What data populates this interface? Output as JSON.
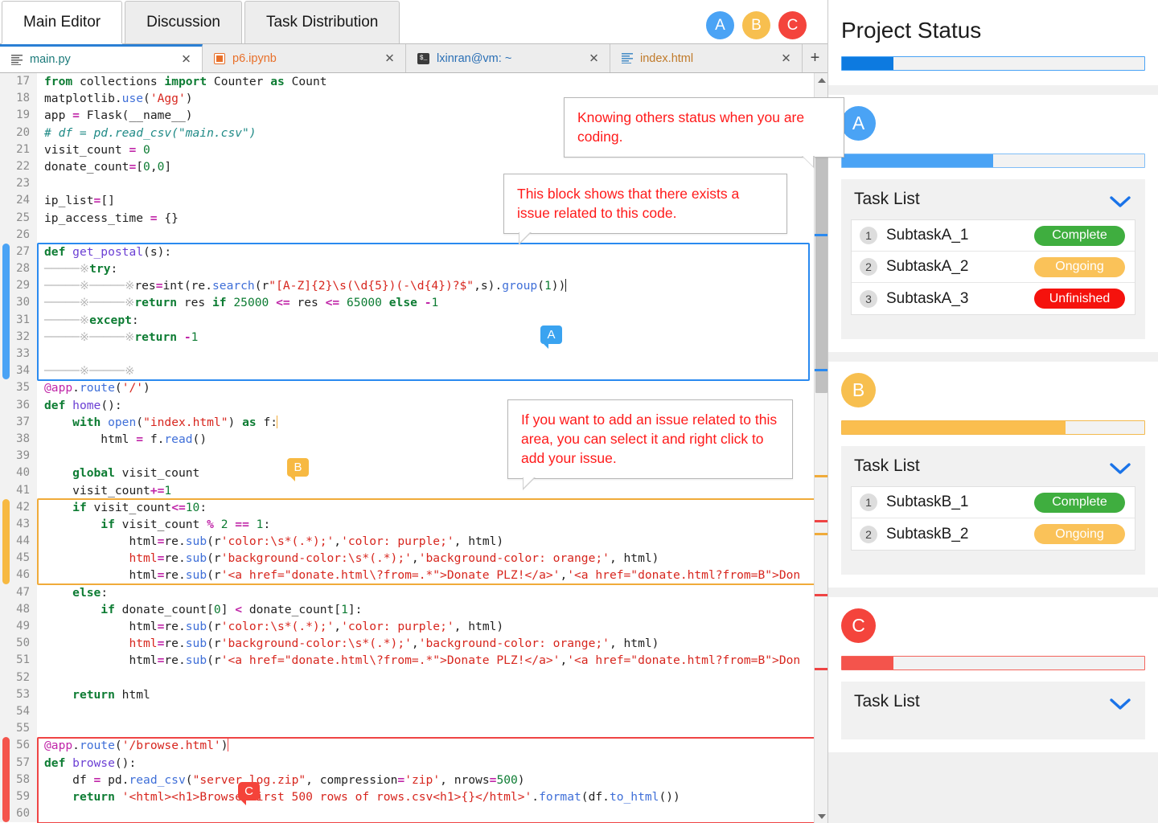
{
  "app_tabs": [
    {
      "label": "Main Editor",
      "active": true
    },
    {
      "label": "Discussion",
      "active": false
    },
    {
      "label": "Task Distribution",
      "active": false
    }
  ],
  "avatars": [
    {
      "letter": "A",
      "color": "#4aa3f5"
    },
    {
      "letter": "B",
      "color": "#f7bf4f"
    },
    {
      "letter": "C",
      "color": "#f4443c"
    }
  ],
  "file_tabs": [
    {
      "name": "main.py",
      "icon": "lines-icon",
      "active": true,
      "close_label": "✕"
    },
    {
      "name": "p6.ipynb",
      "icon": "notebook-icon",
      "active": false,
      "close_label": "✕"
    },
    {
      "name": "lxinran@vm: ~",
      "icon": "terminal-icon",
      "active": false,
      "close_label": "✕"
    },
    {
      "name": "index.html",
      "icon": "lines-icon",
      "active": false,
      "close_label": "✕"
    }
  ],
  "new_tab_label": "+",
  "editor": {
    "first_line": 17,
    "lines": [
      {
        "n": 17,
        "html": "<span class=\"kw\">from</span> <span class=\"pl\">collections</span> <span class=\"kw\">import</span> <span class=\"pl\">Counter</span> <span class=\"kw\">as</span> <span class=\"pl\">Count</span>"
      },
      {
        "n": 18,
        "html": "<span class=\"pl\">matplotlib.</span><span class=\"bi\">use</span><span class=\"pl\">(</span><span class=\"str\">'Agg'</span><span class=\"pl\">)</span>"
      },
      {
        "n": 19,
        "html": "<span class=\"pl\">app </span><span class=\"op\">=</span><span class=\"pl\"> Flask(__name__)</span>"
      },
      {
        "n": 20,
        "html": "<span class=\"com\"># df = pd.read_csv(\"main.csv\")</span>"
      },
      {
        "n": 21,
        "html": "<span class=\"pl\">visit_count </span><span class=\"op\">=</span> <span class=\"num\">0</span>"
      },
      {
        "n": 22,
        "html": "<span class=\"pl\">donate_count</span><span class=\"op\">=</span><span class=\"pl\">[</span><span class=\"num\">0</span><span class=\"pl\">,</span><span class=\"num\">0</span><span class=\"pl\">]</span>"
      },
      {
        "n": 23,
        "html": ""
      },
      {
        "n": 24,
        "html": "<span class=\"pl\">ip_list</span><span class=\"op\">=</span><span class=\"pl\">[]</span>"
      },
      {
        "n": 25,
        "html": "<span class=\"pl\">ip_access_time </span><span class=\"op\">=</span> <span class=\"pl\">{}</span>"
      },
      {
        "n": 26,
        "html": ""
      },
      {
        "n": 27,
        "html": "<span class=\"kw\">def</span> <span class=\"fn\">get_postal</span><span class=\"pl\">(s):</span>"
      },
      {
        "n": 28,
        "html": "<span class=\"gd\">─────※</span><span class=\"kw\">try</span><span class=\"pl\">:</span>"
      },
      {
        "n": 29,
        "html": "<span class=\"gd\">─────※─────※</span><span class=\"pl\">res</span><span class=\"op\">=</span><span class=\"pl\">int(re.</span><span class=\"bi\">search</span><span class=\"pl\">(r</span><span class=\"str\">\"[A-Z]{2}\\s(\\d{5})(-\\d{4})?$\"</span><span class=\"pl\">,s).</span><span class=\"bi\">group</span><span class=\"pl\">(</span><span class=\"num\">1</span><span class=\"pl\">))</span><span class=\"caret\"></span>"
      },
      {
        "n": 30,
        "html": "<span class=\"gd\">─────※─────※</span><span class=\"kw\">return</span> <span class=\"pl\">res</span> <span class=\"kw\">if</span> <span class=\"num\">25000</span> <span class=\"op\">&lt;=</span> <span class=\"pl\">res</span> <span class=\"op\">&lt;=</span> <span class=\"num\">65000</span> <span class=\"kw\">else</span> <span class=\"op\">-</span><span class=\"num\">1</span>"
      },
      {
        "n": 31,
        "html": "<span class=\"gd\">─────※</span><span class=\"kw\">except</span><span class=\"pl\">:</span>"
      },
      {
        "n": 32,
        "html": "<span class=\"gd\">─────※─────※</span><span class=\"kw\">return</span> <span class=\"op\">-</span><span class=\"num\">1</span>"
      },
      {
        "n": 33,
        "html": ""
      },
      {
        "n": 34,
        "html": "<span class=\"gd\">─────※─────※</span>"
      },
      {
        "n": 35,
        "html": "<span class=\"dec\">@app</span><span class=\"pl\">.</span><span class=\"bi\">route</span><span class=\"pl\">(</span><span class=\"str\">'/'</span><span class=\"pl\">)</span>"
      },
      {
        "n": 36,
        "html": "<span class=\"kw\">def</span> <span class=\"fn\">home</span><span class=\"pl\">():</span>"
      },
      {
        "n": 37,
        "html": "    <span class=\"kw\">with</span> <span class=\"bi\">open</span><span class=\"pl\">(</span><span class=\"str\">\"index.html\"</span><span class=\"pl\">) </span><span class=\"kw\">as</span> <span class=\"pl\">f:</span><span class=\"caret b\"></span>"
      },
      {
        "n": 38,
        "html": "        <span class=\"pl\">html </span><span class=\"op\">=</span><span class=\"pl\"> f.</span><span class=\"bi\">read</span><span class=\"pl\">()</span>"
      },
      {
        "n": 39,
        "html": ""
      },
      {
        "n": 40,
        "html": "    <span class=\"kw\">global</span> <span class=\"pl\">visit_count</span>"
      },
      {
        "n": 41,
        "html": "    <span class=\"pl\">visit_count</span><span class=\"op\">+=</span><span class=\"num\">1</span>"
      },
      {
        "n": 42,
        "html": "    <span class=\"kw\">if</span> <span class=\"pl\">visit_count</span><span class=\"op\">&lt;=</span><span class=\"num\">10</span><span class=\"pl\">:</span>"
      },
      {
        "n": 43,
        "html": "        <span class=\"kw\">if</span> <span class=\"pl\">visit_count </span><span class=\"op\">%</span> <span class=\"num\">2</span> <span class=\"op\">==</span> <span class=\"num\">1</span><span class=\"pl\">:</span>"
      },
      {
        "n": 44,
        "html": "            <span class=\"pl\">html</span><span class=\"op\">=</span><span class=\"pl\">re.</span><span class=\"bi\">sub</span><span class=\"pl\">(r</span><span class=\"str\">'color:\\s*(.*);'</span><span class=\"pl\">,</span><span class=\"str\">'color: purple;'</span><span class=\"pl\">, html)</span>"
      },
      {
        "n": 45,
        "html": "            <span class=\"red\">html</span><span class=\"op\">=</span><span class=\"pl\">re.</span><span class=\"bi\">sub</span><span class=\"pl\">(r</span><span class=\"str\">'background-color:\\s*(.*);'</span><span class=\"pl\">,</span><span class=\"str\">'background-color: orange;'</span><span class=\"pl\">, html)</span>"
      },
      {
        "n": 46,
        "html": "            <span class=\"pl\">html</span><span class=\"op\">=</span><span class=\"pl\">re.</span><span class=\"bi\">sub</span><span class=\"pl\">(r</span><span class=\"str\">'&lt;a href=\"donate.html\\?from=.*\"&gt;Donate PLZ!&lt;/a&gt;'</span><span class=\"pl\">,</span><span class=\"str\">'&lt;a href=\"donate.html?from=B\"&gt;Don</span>"
      },
      {
        "n": 47,
        "html": "    <span class=\"kw\">else</span><span class=\"pl\">:</span>"
      },
      {
        "n": 48,
        "html": "        <span class=\"kw\">if</span> <span class=\"pl\">donate_count[</span><span class=\"num\">0</span><span class=\"pl\">] </span><span class=\"op\">&lt;</span><span class=\"pl\"> donate_count[</span><span class=\"num\">1</span><span class=\"pl\">]:</span>"
      },
      {
        "n": 49,
        "html": "            <span class=\"pl\">html</span><span class=\"op\">=</span><span class=\"pl\">re.</span><span class=\"bi\">sub</span><span class=\"pl\">(r</span><span class=\"str\">'color:\\s*(.*);'</span><span class=\"pl\">,</span><span class=\"str\">'color: purple;'</span><span class=\"pl\">, html)</span>"
      },
      {
        "n": 50,
        "html": "            <span class=\"red\">html</span><span class=\"op\">=</span><span class=\"pl\">re.</span><span class=\"bi\">sub</span><span class=\"pl\">(r</span><span class=\"str\">'background-color:\\s*(.*);'</span><span class=\"pl\">,</span><span class=\"str\">'background-color: orange;'</span><span class=\"pl\">, html)</span>"
      },
      {
        "n": 51,
        "html": "            <span class=\"pl\">html</span><span class=\"op\">=</span><span class=\"pl\">re.</span><span class=\"bi\">sub</span><span class=\"pl\">(r</span><span class=\"str\">'&lt;a href=\"donate.html\\?from=.*\"&gt;Donate PLZ!&lt;/a&gt;'</span><span class=\"pl\">,</span><span class=\"str\">'&lt;a href=\"donate.html?from=B\"&gt;Don</span>"
      },
      {
        "n": 52,
        "html": ""
      },
      {
        "n": 53,
        "html": "    <span class=\"kw\">return</span> <span class=\"pl\">html</span>"
      },
      {
        "n": 54,
        "html": ""
      },
      {
        "n": 55,
        "html": ""
      },
      {
        "n": 56,
        "html": "<span class=\"dec\">@app</span><span class=\"pl\">.</span><span class=\"bi\">route</span><span class=\"pl\">(</span><span class=\"str\">'/browse.html'</span><span class=\"pl\">)</span><span class=\"caret c\"></span>"
      },
      {
        "n": 57,
        "html": "<span class=\"kw\">def</span> <span class=\"fn\">browse</span><span class=\"pl\">():</span>"
      },
      {
        "n": 58,
        "html": "    <span class=\"pl\">df </span><span class=\"op\">=</span><span class=\"pl\"> pd.</span><span class=\"bi\">read_csv</span><span class=\"pl\">(</span><span class=\"str\">\"server_log.zip\"</span><span class=\"pl\">, compression</span><span class=\"op\">=</span><span class=\"str\">'zip'</span><span class=\"pl\">, nrows</span><span class=\"op\">=</span><span class=\"num\">500</span><span class=\"pl\">)</span>"
      },
      {
        "n": 59,
        "html": "    <span class=\"kw\">return</span> <span class=\"str\">'&lt;html&gt;&lt;h1&gt;Browse first 500 rows of rows.csv&lt;h1&gt;{}&lt;/html&gt;'</span><span class=\"pl\">.</span><span class=\"bi\">format</span><span class=\"pl\">(df.</span><span class=\"bi\">to_html</span><span class=\"pl\">())</span>"
      },
      {
        "n": 60,
        "html": ""
      }
    ],
    "pins": [
      {
        "letter": "A",
        "color_class": "blue"
      },
      {
        "letter": "B",
        "color_class": "orange"
      },
      {
        "letter": "C",
        "color_class": "redp"
      }
    ]
  },
  "callouts": [
    {
      "text": "Knowing others status when you are coding."
    },
    {
      "text": "This block shows that there exists a issue related to this code."
    },
    {
      "text": "If you want to add an issue related to this area, you can select it and right click to add your issue."
    }
  ],
  "panel": {
    "title": "Project Status",
    "overall_progress": 17,
    "members": [
      {
        "letter": "A",
        "color": "#4aa3f5",
        "bar_color": "#4aa3f5",
        "progress": 50,
        "tasklist_label": "Task List",
        "tasks": [
          {
            "index": "1",
            "name": "SubtaskA_1",
            "status": "Complete",
            "status_color": "#3fae3f"
          },
          {
            "index": "2",
            "name": "SubtaskA_2",
            "status": "Ongoing",
            "status_color": "#fac259"
          },
          {
            "index": "3",
            "name": "SubtaskA_3",
            "status": "Unfinished",
            "status_color": "#f5120d"
          }
        ]
      },
      {
        "letter": "B",
        "color": "#f7bf4f",
        "bar_color": "#fabe4f",
        "progress": 74,
        "tasklist_label": "Task List",
        "tasks": [
          {
            "index": "1",
            "name": "SubtaskB_1",
            "status": "Complete",
            "status_color": "#3fae3f"
          },
          {
            "index": "2",
            "name": "SubtaskB_2",
            "status": "Ongoing",
            "status_color": "#fac259"
          }
        ]
      },
      {
        "letter": "C",
        "color": "#f4443c",
        "bar_color": "#f4544c",
        "progress": 17,
        "tasklist_label": "Task List",
        "tasks": []
      }
    ]
  }
}
